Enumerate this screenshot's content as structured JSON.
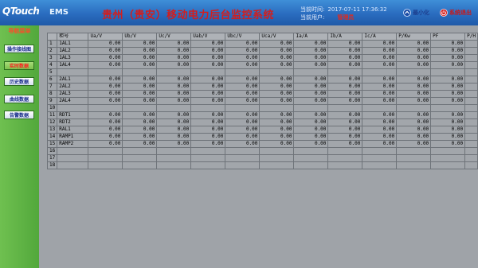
{
  "header": {
    "logo": "QTouch",
    "ems": "EMS",
    "title": "贵州（贵安）移动电力后台监控系统",
    "time_label": "当前时间:",
    "time_value": "2017-07-11 17:36:32",
    "user_label": "当前用户:",
    "user_value": "管理员",
    "minimize_label": "最小化",
    "exit_label": "系统退出"
  },
  "sidebar": {
    "title": "导航菜单",
    "items": [
      {
        "label": "操作接线图",
        "state": "normal"
      },
      {
        "label": "实时数据",
        "state": "active"
      },
      {
        "label": "历史数据",
        "state": "normal"
      },
      {
        "label": "曲线数据",
        "state": "normal"
      },
      {
        "label": "告警数据",
        "state": "normal"
      }
    ]
  },
  "table": {
    "columns": [
      "柜号",
      "Ua/V",
      "Ub/V",
      "Uc/V",
      "Uab/V",
      "Ubc/V",
      "Uca/V",
      "Ia/A",
      "Ib/A",
      "Ic/A",
      "P/Kw",
      "PF",
      "P/H"
    ],
    "rows": [
      {
        "no": "1",
        "name": "1AL1",
        "values": [
          "0.00",
          "0.00",
          "0.00",
          "0.00",
          "0.00",
          "0.00",
          "0.00",
          "0.00",
          "0.00",
          "0.00",
          "0.00"
        ]
      },
      {
        "no": "2",
        "name": "1AL2",
        "values": [
          "0.00",
          "0.00",
          "0.00",
          "0.00",
          "0.00",
          "0.00",
          "0.00",
          "0.00",
          "0.00",
          "0.00",
          "0.00"
        ]
      },
      {
        "no": "3",
        "name": "1AL3",
        "values": [
          "0.00",
          "0.00",
          "0.00",
          "0.00",
          "0.00",
          "0.00",
          "0.00",
          "0.00",
          "0.00",
          "0.00",
          "0.00"
        ]
      },
      {
        "no": "4",
        "name": "1AL4",
        "values": [
          "0.00",
          "0.00",
          "0.00",
          "0.00",
          "0.00",
          "0.00",
          "0.00",
          "0.00",
          "0.00",
          "0.00",
          "0.00"
        ]
      },
      {
        "no": "5",
        "name": "",
        "values": []
      },
      {
        "no": "6",
        "name": "2AL1",
        "values": [
          "0.00",
          "0.00",
          "0.00",
          "0.00",
          "0.00",
          "0.00",
          "0.00",
          "0.00",
          "0.00",
          "0.00",
          "0.00"
        ]
      },
      {
        "no": "7",
        "name": "2AL2",
        "values": [
          "0.00",
          "0.00",
          "0.00",
          "0.00",
          "0.00",
          "0.00",
          "0.00",
          "0.00",
          "0.00",
          "0.00",
          "0.00"
        ]
      },
      {
        "no": "8",
        "name": "2AL3",
        "values": [
          "0.00",
          "0.00",
          "0.00",
          "0.00",
          "0.00",
          "0.00",
          "0.00",
          "0.00",
          "0.00",
          "0.00",
          "0.00"
        ]
      },
      {
        "no": "9",
        "name": "2AL4",
        "values": [
          "0.00",
          "0.00",
          "0.00",
          "0.00",
          "0.00",
          "0.00",
          "0.00",
          "0.00",
          "0.00",
          "0.00",
          "0.00"
        ]
      },
      {
        "no": "10",
        "name": "",
        "values": []
      },
      {
        "no": "11",
        "name": "RDT1",
        "values": [
          "0.00",
          "0.00",
          "0.00",
          "0.00",
          "0.00",
          "0.00",
          "0.00",
          "0.00",
          "0.00",
          "0.00",
          "0.00"
        ]
      },
      {
        "no": "12",
        "name": "RDT2",
        "values": [
          "0.00",
          "0.00",
          "0.00",
          "0.00",
          "0.00",
          "0.00",
          "0.00",
          "0.00",
          "0.00",
          "0.00",
          "0.00"
        ]
      },
      {
        "no": "13",
        "name": "RAL1",
        "values": [
          "0.00",
          "0.00",
          "0.00",
          "0.00",
          "0.00",
          "0.00",
          "0.00",
          "0.00",
          "0.00",
          "0.00",
          "0.00"
        ]
      },
      {
        "no": "14",
        "name": "RAMP1",
        "values": [
          "0.00",
          "0.00",
          "0.00",
          "0.00",
          "0.00",
          "0.00",
          "0.00",
          "0.00",
          "0.00",
          "0.00",
          "0.00"
        ]
      },
      {
        "no": "15",
        "name": "RAMP2",
        "values": [
          "0.00",
          "0.00",
          "0.00",
          "0.00",
          "0.00",
          "0.00",
          "0.00",
          "0.00",
          "0.00",
          "0.00",
          "0.00"
        ]
      },
      {
        "no": "16",
        "name": "",
        "values": []
      },
      {
        "no": "17",
        "name": "",
        "values": []
      },
      {
        "no": "18",
        "name": "",
        "values": []
      }
    ]
  },
  "colors": {
    "header_blue": "#2a6cbf",
    "sidebar_green": "#5cb040",
    "title_red": "#d21e1e",
    "grid_gray": "#a2a6ab"
  }
}
